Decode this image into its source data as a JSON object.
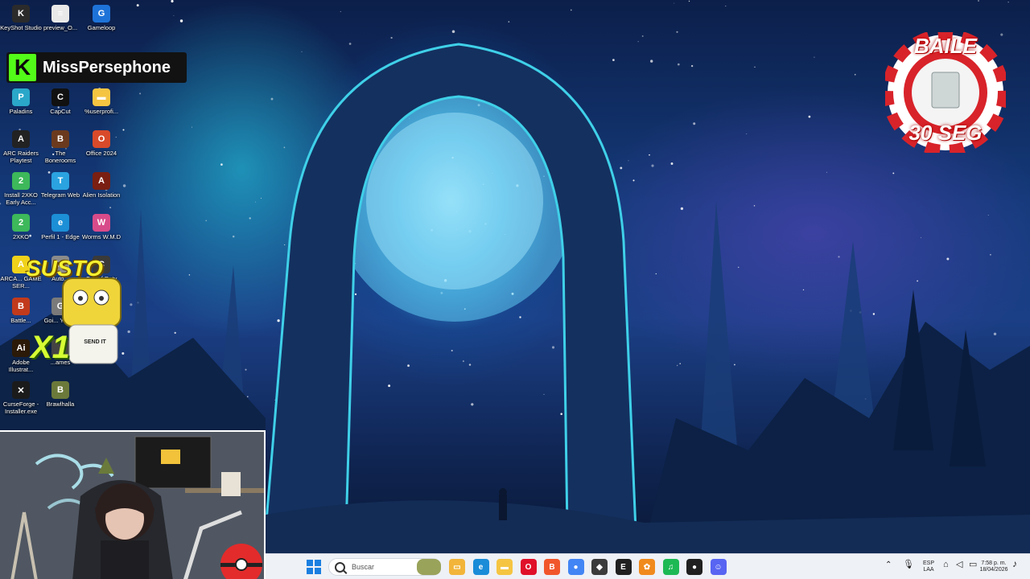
{
  "desktop": {
    "icons": [
      {
        "label": "KeyShot Studio",
        "color": "#2b2b2b",
        "glyph": "K"
      },
      {
        "label": "preview_O...",
        "color": "#e9e9e9",
        "glyph": "≡"
      },
      {
        "label": "Gameloop",
        "color": "#1e73d8",
        "glyph": "G"
      },
      {
        "label": "Paladins",
        "color": "#2aa7c9",
        "glyph": "P"
      },
      {
        "label": "CapCut",
        "color": "#111111",
        "glyph": "C"
      },
      {
        "label": "%userprofi...",
        "color": "#f5c542",
        "glyph": "▬"
      },
      {
        "label": "ARC Raiders Playtest",
        "color": "#222222",
        "glyph": "A"
      },
      {
        "label": "The Bonerooms",
        "color": "#6b3a1e",
        "glyph": "B"
      },
      {
        "label": "Office 2024",
        "color": "#d84a2a",
        "glyph": "O"
      },
      {
        "label": "Install 2XKO Early Acc...",
        "color": "#3db85a",
        "glyph": "2"
      },
      {
        "label": "Telegram Web",
        "color": "#2aa3e0",
        "glyph": "T"
      },
      {
        "label": "Alien Isolation",
        "color": "#7a1f12",
        "glyph": "A"
      },
      {
        "label": "2XKO",
        "color": "#3db85a",
        "glyph": "2"
      },
      {
        "label": "Perfil 1 - Edge",
        "color": "#1c8fd6",
        "glyph": "e"
      },
      {
        "label": "Worms W.M.D",
        "color": "#d84b8a",
        "glyph": "W"
      },
      {
        "label": "ARCA... GAME SER...",
        "color": "#f0d21a",
        "glyph": "A"
      },
      {
        "label": "Auto...",
        "color": "#8b8b8b",
        "glyph": "A"
      },
      {
        "label": "Call of Duty",
        "color": "#3a3a3a",
        "glyph": "C"
      },
      {
        "label": "Battle...",
        "color": "#c23a1c",
        "glyph": "B"
      },
      {
        "label": "Goi... Your...",
        "color": "#7a7a7a",
        "glyph": "G"
      },
      {
        "label": "",
        "color": "#555555",
        "glyph": ""
      },
      {
        "label": "Adobe Illustrat...",
        "color": "#2b1a07",
        "glyph": "Ai"
      },
      {
        "label": "...ames",
        "color": "#444444",
        "glyph": ""
      },
      {
        "label": "",
        "color": "#555555",
        "glyph": ""
      },
      {
        "label": "CurseForge - Installer.exe",
        "color": "#1b1b1b",
        "glyph": "✕"
      },
      {
        "label": "Brawlhalla",
        "color": "#6b7a3a",
        "glyph": "B"
      }
    ]
  },
  "overlay": {
    "streamer_name": "MissPersephone",
    "platform_glyph": "K",
    "chip_top": "BAILE",
    "chip_bottom": "30 SEG",
    "sticker_top": "SUSTO",
    "sticker_bottom": "X1",
    "sticker_shirt": "SEND IT"
  },
  "taskbar": {
    "search_placeholder": "Buscar",
    "apps": [
      {
        "name": "file-explorer-icon",
        "color": "#f2b53a",
        "glyph": "▭"
      },
      {
        "name": "edge-icon",
        "color": "#1a8cd8",
        "glyph": "e"
      },
      {
        "name": "folder-icon",
        "color": "#f5c542",
        "glyph": "▬"
      },
      {
        "name": "opera-icon",
        "color": "#e0102a",
        "glyph": "O"
      },
      {
        "name": "brave-icon",
        "color": "#f1562b",
        "glyph": "B"
      },
      {
        "name": "chrome-icon",
        "color": "#4285f4",
        "glyph": "●"
      },
      {
        "name": "app-icon",
        "color": "#3b3b3b",
        "glyph": "◆"
      },
      {
        "name": "epic-games-icon",
        "color": "#202020",
        "glyph": "E"
      },
      {
        "name": "app-icon-orange",
        "color": "#f08a1c",
        "glyph": "✿"
      },
      {
        "name": "spotify-icon",
        "color": "#1db954",
        "glyph": "♫"
      },
      {
        "name": "app-icon-dark",
        "color": "#202020",
        "glyph": "●"
      },
      {
        "name": "discord-icon",
        "color": "#5865f2",
        "glyph": "☺"
      }
    ],
    "lang_top": "ESP",
    "lang_bottom": "LAA",
    "time": "7:58 p. m.",
    "date": "18/04/2026"
  }
}
